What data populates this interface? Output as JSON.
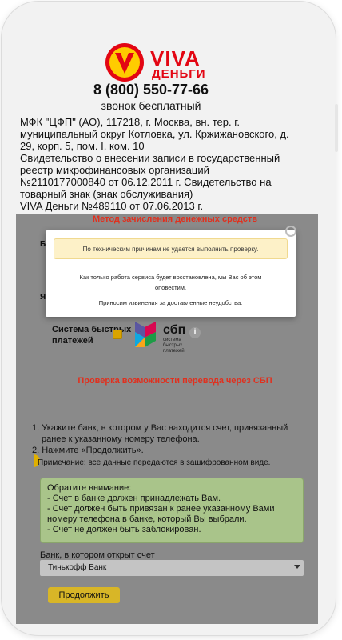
{
  "header": {
    "brand_top": "VIVA",
    "brand_bottom": "ДЕНЬГИ",
    "phone": "8 (800) 550-77-66",
    "phone_note": "звонок бесплатный",
    "company_lines": [
      "МФК \"ЦФП\" (АО), 117218, г. Москва, вн. тер. г.",
      "муниципальный округ Котловка, ул. Кржижановского, д.",
      "29, корп. 5, пом. I, ком. 10",
      "Свидетельство о внесении записи в государственный",
      "реестр микрофинансовых организаций",
      "№2110177000840 от 06.12.2011 г. Свидетельство на",
      "товарный знак (знак обслуживания)",
      "VIVA Деньги №489110 от 07.06.2013 г."
    ]
  },
  "page": {
    "method_title": "Метод зачисления денежных средств",
    "sbp_label_1": "Система быстрых",
    "sbp_label_2": "платежей",
    "sbp_logo_text": "сбп",
    "sbp_logo_sub": "система быстрых платежей",
    "info_icon": "i",
    "partial_b": "Ба",
    "partial_ya": "Як",
    "check_title": "Проверка возможности перевода через СБП",
    "steps": [
      "1. Укажите банк, в котором у Вас находится счет, привязанный",
      "ранее к указанному номеру телефона.",
      "2. Нажмите «Продолжить»."
    ],
    "note": "Примечание: все данные передаются в зашифрованном виде.",
    "attention_lines": [
      "Обратите внимание:",
      "- Счет в банке должен принадлежать Вам.",
      "- Счет должен быть привязан к ранее указанному Вами",
      "номеру телефона в банке, который Вы выбрали.",
      "- Счет не должен быть заблокирован."
    ],
    "bank_label": "Банк, в котором открыт счет",
    "bank_selected": "Тинькофф Банк",
    "continue_button": "Продолжить"
  },
  "modal": {
    "alert": "По техническим причинам не удается выполнить проверку.",
    "text_1": "Как только работа сервиса будет восстановлена, мы Вас об этом",
    "text_2": "оповестим.",
    "text_3": "Приносим извинения за доставленные неудобства."
  },
  "colors": {
    "brand_red": "#e30613",
    "overlay_grey": "#8a8a8a",
    "attention_green": "#a9c48a",
    "button_yellow": "#d8b627",
    "alert_yellow": "#fdf1c8"
  }
}
